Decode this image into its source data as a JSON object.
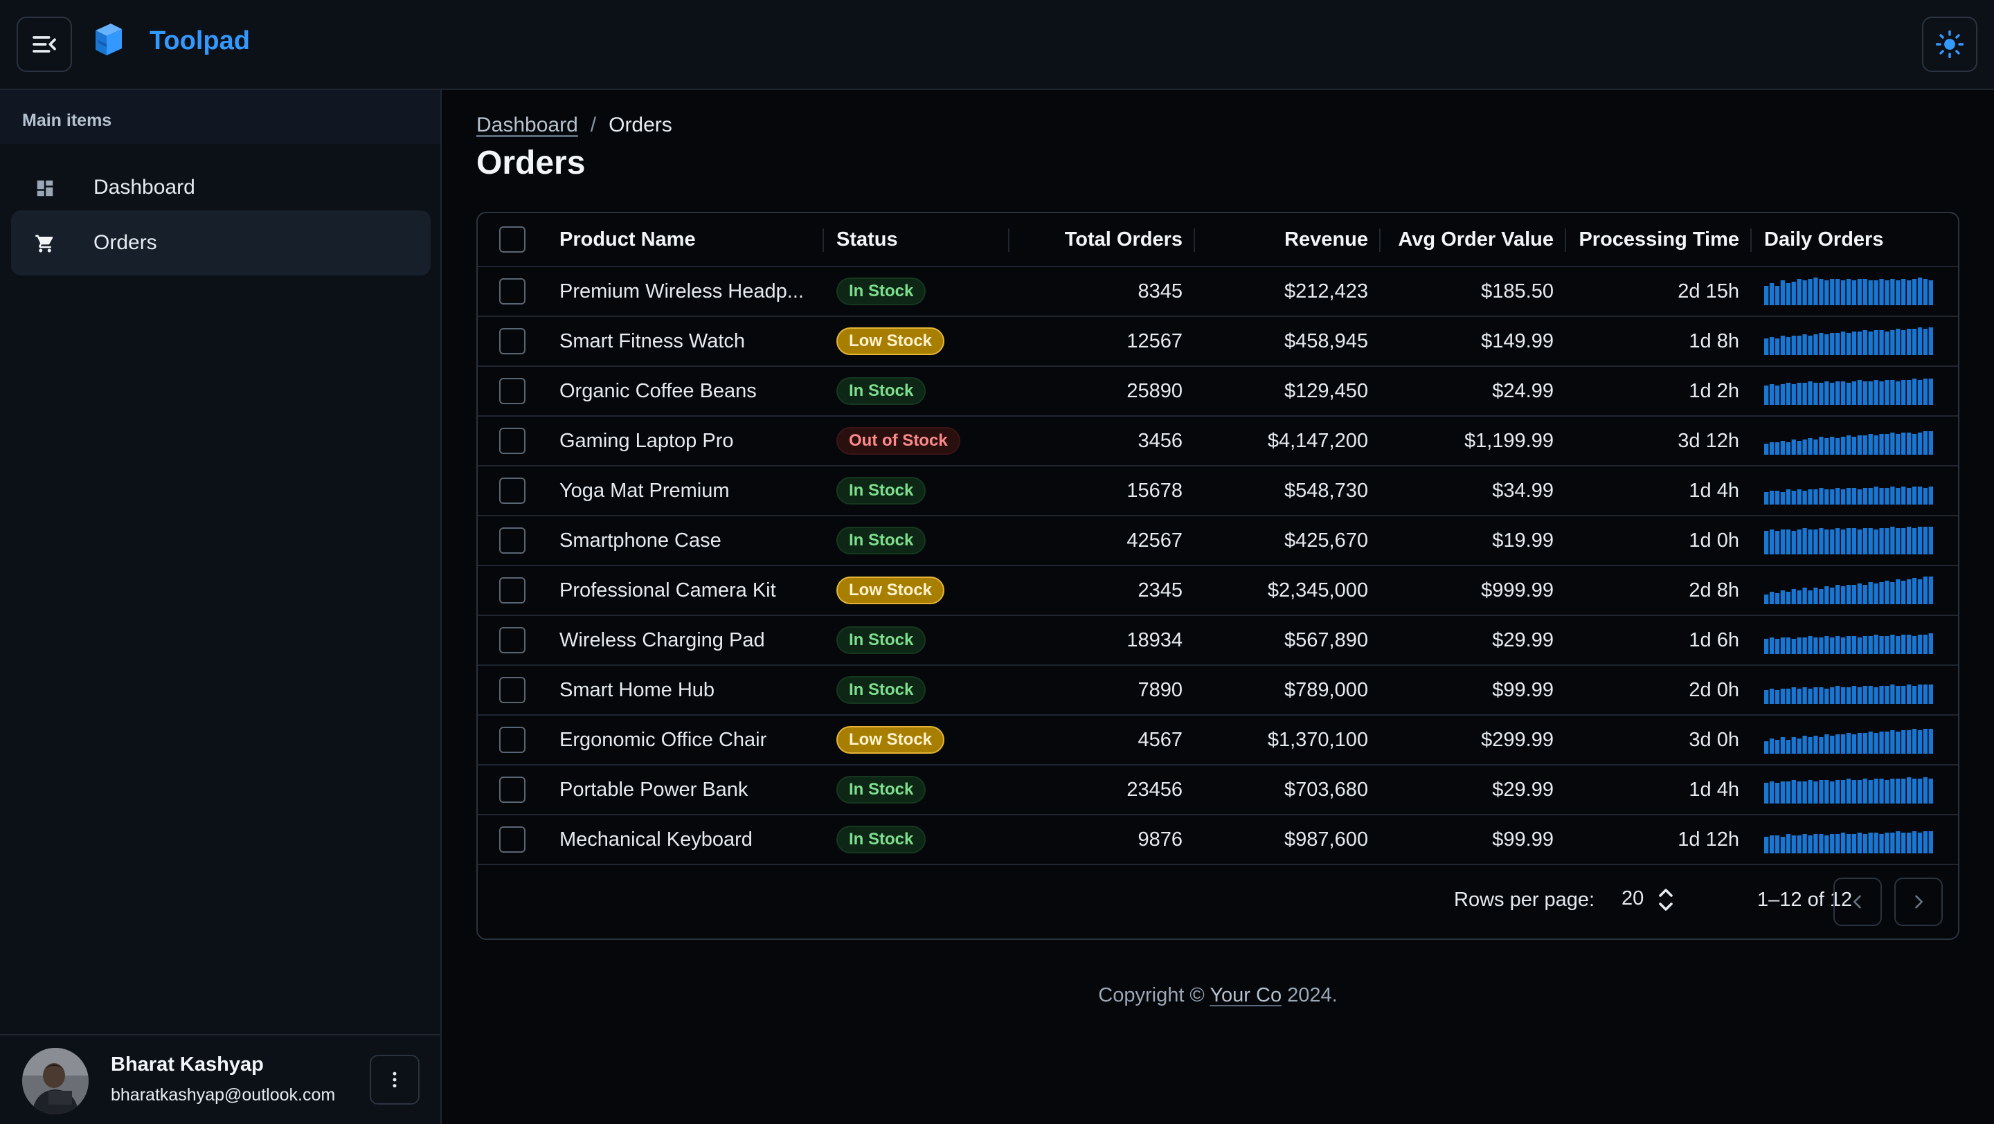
{
  "app": {
    "brand": "Toolpad"
  },
  "sidebar": {
    "section_title": "Main items",
    "items": [
      {
        "label": "Dashboard",
        "icon": "dashboard-icon",
        "active": false
      },
      {
        "label": "Orders",
        "icon": "shopping-cart-icon",
        "active": true
      }
    ],
    "user": {
      "name": "Bharat Kashyap",
      "email": "bharatkashyap@outlook.com"
    }
  },
  "breadcrumb": {
    "parent": "Dashboard",
    "separator": "/",
    "current": "Orders"
  },
  "page_title": "Orders",
  "table": {
    "columns": {
      "name": "Product Name",
      "status": "Status",
      "total": "Total Orders",
      "revenue": "Revenue",
      "avg": "Avg Order Value",
      "proc": "Processing Time",
      "daily": "Daily Orders"
    },
    "rows": [
      {
        "name": "Premium Wireless Headp...",
        "status": "In Stock",
        "status_kind": "in",
        "total": "8345",
        "revenue": "$212,423",
        "avg": "$185.50",
        "proc": "2d 15h",
        "daily": [
          0.7,
          0.8,
          0.7,
          0.9,
          0.8,
          0.85,
          0.95,
          0.9,
          0.95,
          1,
          0.95,
          0.9,
          0.95,
          0.95,
          0.9,
          0.95,
          0.9,
          0.95,
          0.95,
          0.9,
          0.9,
          0.95,
          0.9,
          0.95,
          0.9,
          0.95,
          0.9,
          0.95,
          1,
          0.95,
          0.9
        ]
      },
      {
        "name": "Smart Fitness Watch",
        "status": "Low Stock",
        "status_kind": "low",
        "total": "12567",
        "revenue": "$458,945",
        "avg": "$149.99",
        "proc": "1d 8h",
        "daily": [
          0.6,
          0.65,
          0.6,
          0.7,
          0.65,
          0.7,
          0.7,
          0.75,
          0.7,
          0.75,
          0.8,
          0.75,
          0.8,
          0.8,
          0.85,
          0.8,
          0.85,
          0.85,
          0.9,
          0.85,
          0.9,
          0.9,
          0.85,
          0.9,
          0.95,
          0.9,
          0.95,
          0.95,
          1,
          0.95,
          1
        ]
      },
      {
        "name": "Organic Coffee Beans",
        "status": "In Stock",
        "status_kind": "in",
        "total": "25890",
        "revenue": "$129,450",
        "avg": "$24.99",
        "proc": "1d 2h",
        "daily": [
          0.7,
          0.75,
          0.7,
          0.75,
          0.8,
          0.75,
          0.8,
          0.8,
          0.85,
          0.8,
          0.8,
          0.85,
          0.8,
          0.85,
          0.85,
          0.8,
          0.85,
          0.9,
          0.85,
          0.85,
          0.9,
          0.85,
          0.9,
          0.9,
          0.85,
          0.9,
          0.9,
          0.95,
          0.9,
          0.95,
          0.95
        ]
      },
      {
        "name": "Gaming Laptop Pro",
        "status": "Out of Stock",
        "status_kind": "out",
        "total": "3456",
        "revenue": "$4,147,200",
        "avg": "$1,199.99",
        "proc": "3d 12h",
        "daily": [
          0.4,
          0.45,
          0.45,
          0.5,
          0.45,
          0.55,
          0.5,
          0.55,
          0.6,
          0.55,
          0.65,
          0.6,
          0.65,
          0.6,
          0.65,
          0.7,
          0.65,
          0.7,
          0.7,
          0.75,
          0.7,
          0.75,
          0.75,
          0.8,
          0.75,
          0.8,
          0.8,
          0.75,
          0.8,
          0.85,
          0.85
        ]
      },
      {
        "name": "Yoga Mat Premium",
        "status": "In Stock",
        "status_kind": "in",
        "total": "15678",
        "revenue": "$548,730",
        "avg": "$34.99",
        "proc": "1d 4h",
        "daily": [
          0.45,
          0.5,
          0.5,
          0.45,
          0.55,
          0.5,
          0.55,
          0.5,
          0.55,
          0.55,
          0.6,
          0.55,
          0.55,
          0.6,
          0.55,
          0.6,
          0.6,
          0.55,
          0.6,
          0.6,
          0.65,
          0.6,
          0.6,
          0.65,
          0.6,
          0.65,
          0.6,
          0.65,
          0.65,
          0.6,
          0.65
        ]
      },
      {
        "name": "Smartphone Case",
        "status": "In Stock",
        "status_kind": "in",
        "total": "42567",
        "revenue": "$425,670",
        "avg": "$19.99",
        "proc": "1d 0h",
        "daily": [
          0.85,
          0.9,
          0.85,
          0.9,
          0.9,
          0.85,
          0.9,
          0.95,
          0.9,
          0.9,
          0.95,
          0.9,
          0.9,
          0.95,
          0.9,
          0.95,
          0.95,
          0.9,
          0.95,
          0.95,
          0.9,
          0.95,
          0.95,
          1,
          0.95,
          0.95,
          1,
          0.95,
          1,
          1,
          1
        ]
      },
      {
        "name": "Professional Camera Kit",
        "status": "Low Stock",
        "status_kind": "low",
        "total": "2345",
        "revenue": "$2,345,000",
        "avg": "$999.99",
        "proc": "2d 8h",
        "daily": [
          0.35,
          0.45,
          0.4,
          0.5,
          0.45,
          0.55,
          0.5,
          0.6,
          0.5,
          0.6,
          0.55,
          0.65,
          0.6,
          0.7,
          0.65,
          0.7,
          0.7,
          0.75,
          0.7,
          0.8,
          0.75,
          0.8,
          0.85,
          0.8,
          0.9,
          0.85,
          0.9,
          0.95,
          0.9,
          1,
          1
        ]
      },
      {
        "name": "Wireless Charging Pad",
        "status": "In Stock",
        "status_kind": "in",
        "total": "18934",
        "revenue": "$567,890",
        "avg": "$29.99",
        "proc": "1d 6h",
        "daily": [
          0.55,
          0.6,
          0.55,
          0.6,
          0.6,
          0.55,
          0.6,
          0.6,
          0.65,
          0.6,
          0.6,
          0.65,
          0.6,
          0.65,
          0.6,
          0.65,
          0.65,
          0.6,
          0.65,
          0.65,
          0.7,
          0.65,
          0.65,
          0.7,
          0.65,
          0.7,
          0.7,
          0.65,
          0.7,
          0.7,
          0.75
        ]
      },
      {
        "name": "Smart Home Hub",
        "status": "In Stock",
        "status_kind": "in",
        "total": "7890",
        "revenue": "$789,000",
        "avg": "$99.99",
        "proc": "2d 0h",
        "daily": [
          0.5,
          0.55,
          0.5,
          0.55,
          0.55,
          0.6,
          0.55,
          0.6,
          0.55,
          0.6,
          0.6,
          0.55,
          0.6,
          0.65,
          0.6,
          0.6,
          0.65,
          0.6,
          0.65,
          0.65,
          0.6,
          0.65,
          0.65,
          0.7,
          0.65,
          0.65,
          0.7,
          0.65,
          0.7,
          0.7,
          0.7
        ]
      },
      {
        "name": "Ergonomic Office Chair",
        "status": "Low Stock",
        "status_kind": "low",
        "total": "4567",
        "revenue": "$1,370,100",
        "avg": "$299.99",
        "proc": "3d 0h",
        "daily": [
          0.45,
          0.55,
          0.5,
          0.6,
          0.5,
          0.6,
          0.55,
          0.65,
          0.6,
          0.65,
          0.6,
          0.7,
          0.65,
          0.7,
          0.7,
          0.75,
          0.7,
          0.75,
          0.75,
          0.8,
          0.75,
          0.8,
          0.8,
          0.85,
          0.8,
          0.85,
          0.85,
          0.9,
          0.85,
          0.9,
          0.9
        ]
      },
      {
        "name": "Portable Power Bank",
        "status": "In Stock",
        "status_kind": "in",
        "total": "23456",
        "revenue": "$703,680",
        "avg": "$29.99",
        "proc": "1d 4h",
        "daily": [
          0.75,
          0.8,
          0.75,
          0.8,
          0.8,
          0.85,
          0.8,
          0.8,
          0.85,
          0.8,
          0.85,
          0.85,
          0.8,
          0.85,
          0.85,
          0.9,
          0.85,
          0.85,
          0.9,
          0.85,
          0.9,
          0.9,
          0.85,
          0.9,
          0.9,
          0.9,
          0.95,
          0.9,
          0.9,
          0.95,
          0.9
        ]
      },
      {
        "name": "Mechanical Keyboard",
        "status": "In Stock",
        "status_kind": "in",
        "total": "9876",
        "revenue": "$987,600",
        "avg": "$99.99",
        "proc": "1d 12h",
        "daily": [
          0.6,
          0.65,
          0.65,
          0.6,
          0.7,
          0.65,
          0.65,
          0.7,
          0.65,
          0.7,
          0.7,
          0.65,
          0.7,
          0.7,
          0.75,
          0.7,
          0.7,
          0.75,
          0.7,
          0.75,
          0.75,
          0.7,
          0.75,
          0.75,
          0.8,
          0.75,
          0.75,
          0.8,
          0.75,
          0.8,
          0.8
        ]
      }
    ],
    "footer": {
      "rows_per_page_label": "Rows per page:",
      "rows_per_page": "20",
      "page_info": "1–12 of 12"
    }
  },
  "footer": {
    "prefix": "Copyright ©",
    "company": "Your Co",
    "suffix": "2024."
  },
  "colors": {
    "accent": "#3399ff",
    "spark": "#1976d2"
  }
}
